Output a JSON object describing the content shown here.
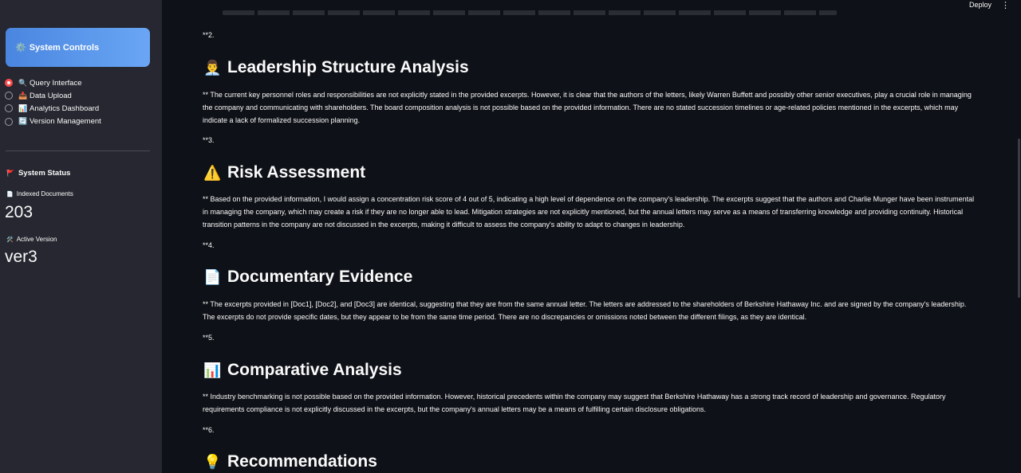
{
  "sidebar": {
    "title_icon": "gear-icon",
    "title": "System Controls",
    "nav": [
      {
        "icon": "magnifier-icon",
        "glyph": "🔍",
        "label": "Query Interface",
        "selected": true
      },
      {
        "icon": "inbox-tray-icon",
        "glyph": "📥",
        "label": "Data Upload",
        "selected": false
      },
      {
        "icon": "bar-chart-icon",
        "glyph": "📊",
        "label": "Analytics Dashboard",
        "selected": false
      },
      {
        "icon": "refresh-icon",
        "glyph": "🔄",
        "label": "Version Management",
        "selected": false
      }
    ],
    "status_title": "System Status",
    "indexed_label": "Indexed Documents",
    "indexed_value": "203",
    "version_label": "Active Version",
    "version_value": "ver3"
  },
  "topbar": {
    "deploy_label": "Deploy",
    "menu_glyph": "⋮"
  },
  "content": {
    "marker_2": "**2.",
    "leadership": {
      "icon": "man-technologist-icon",
      "title": "Leadership Structure Analysis",
      "body": "** The current key personnel roles and responsibilities are not explicitly stated in the provided excerpts. However, it is clear that the authors of the letters, likely Warren Buffett and possibly other senior executives, play a crucial role in managing the company and communicating with shareholders. The board composition analysis is not possible based on the provided information. There are no stated succession timelines or age-related policies mentioned in the excerpts, which may indicate a lack of formalized succession planning."
    },
    "marker_3": "**3.",
    "risk": {
      "icon": "warning-icon",
      "title": "Risk Assessment",
      "body": "** Based on the provided information, I would assign a concentration risk score of 4 out of 5, indicating a high level of dependence on the company's leadership. The excerpts suggest that the authors and Charlie Munger have been instrumental in managing the company, which may create a risk if they are no longer able to lead. Mitigation strategies are not explicitly mentioned, but the annual letters may serve as a means of transferring knowledge and providing continuity. Historical transition patterns in the company are not discussed in the excerpts, making it difficult to assess the company's ability to adapt to changes in leadership."
    },
    "marker_4": "**4.",
    "evidence": {
      "icon": "document-icon",
      "title": "Documentary Evidence",
      "body": "** The excerpts provided in [Doc1], [Doc2], and [Doc3] are identical, suggesting that they are from the same annual letter. The letters are addressed to the shareholders of Berkshire Hathaway Inc. and are signed by the company's leadership. The excerpts do not provide specific dates, but they appear to be from the same time period. There are no discrepancies or omissions noted between the different filings, as they are identical."
    },
    "marker_5": "**5.",
    "comparative": {
      "icon": "bar-chart-icon",
      "title": "Comparative Analysis",
      "body": "** Industry benchmarking is not possible based on the provided information. However, historical precedents within the company may suggest that Berkshire Hathaway has a strong track record of leadership and governance. Regulatory requirements compliance is not explicitly discussed in the excerpts, but the company's annual letters may be a means of fulfilling certain disclosure obligations."
    },
    "marker_6": "**6.",
    "recommendations": {
      "icon": "light-bulb-icon",
      "title": "Recommendations"
    }
  }
}
